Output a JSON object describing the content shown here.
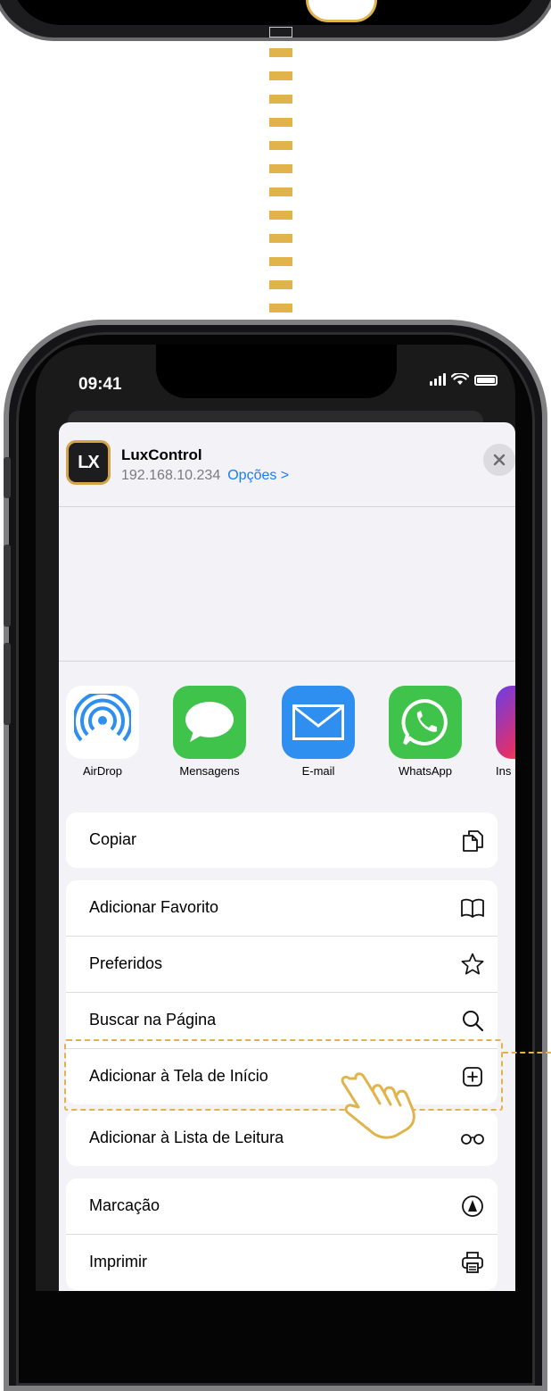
{
  "status_bar": {
    "time": "09:41"
  },
  "share_sheet": {
    "app_name": "LuxControl",
    "app_logo_text": "LX",
    "address": "192.168.10.234",
    "options_label": "Opções >",
    "apps": [
      {
        "label": "AirDrop",
        "icon": "airdrop-icon"
      },
      {
        "label": "Mensagens",
        "icon": "messages-icon"
      },
      {
        "label": "E-mail",
        "icon": "mail-icon"
      },
      {
        "label": "WhatsApp",
        "icon": "whatsapp-icon"
      },
      {
        "label": "Ins",
        "icon": "instagram-icon"
      }
    ],
    "actions": [
      {
        "label": "Copiar",
        "icon": "copy-icon"
      },
      {
        "label": "Adicionar Favorito",
        "icon": "book-icon"
      },
      {
        "label": "Preferidos",
        "icon": "star-icon"
      },
      {
        "label": "Buscar na Página",
        "icon": "search-icon"
      },
      {
        "label": "Adicionar à Tela de Início",
        "icon": "add-square-icon"
      },
      {
        "label": "Adicionar à Lista de Leitura",
        "icon": "glasses-icon"
      },
      {
        "label": "Marcação",
        "icon": "markup-icon"
      },
      {
        "label": "Imprimir",
        "icon": "print-icon"
      }
    ]
  },
  "colors": {
    "accent": "#e0b44a",
    "link": "#1a7ef2",
    "sheet_background": "#f2f2f7"
  }
}
